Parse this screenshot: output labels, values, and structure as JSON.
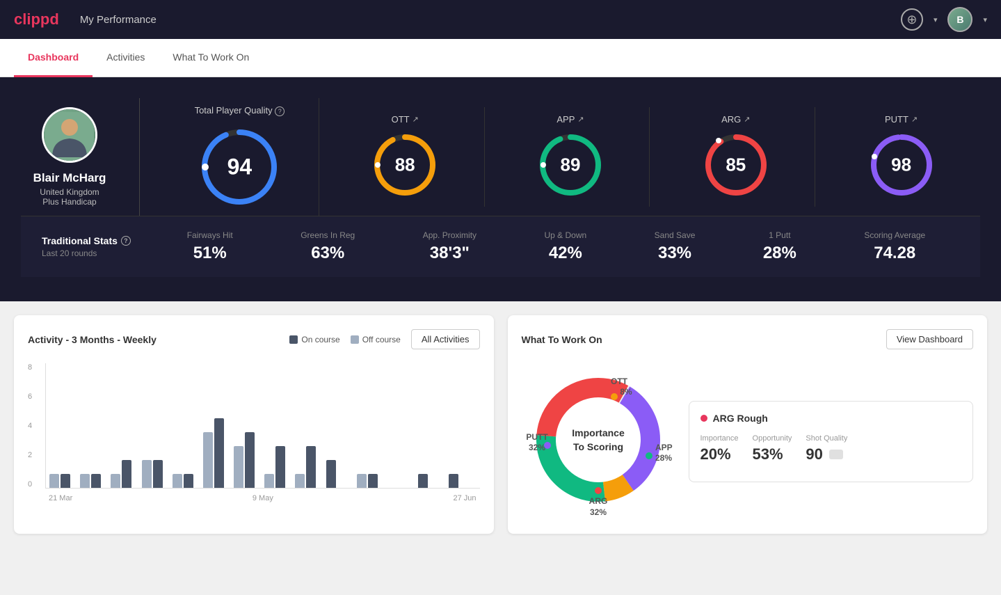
{
  "app": {
    "logo": "clippd",
    "header_title": "My Performance"
  },
  "nav": {
    "tabs": [
      {
        "id": "dashboard",
        "label": "Dashboard",
        "active": true
      },
      {
        "id": "activities",
        "label": "Activities",
        "active": false
      },
      {
        "id": "what-to-work-on",
        "label": "What To Work On",
        "active": false
      }
    ]
  },
  "player": {
    "name": "Blair McHarg",
    "country": "United Kingdom",
    "handicap": "Plus Handicap"
  },
  "scores": {
    "total": {
      "label": "Total Player Quality",
      "value": 94,
      "color": "#3b82f6"
    },
    "ott": {
      "label": "OTT",
      "value": 88,
      "color": "#f59e0b",
      "trend": "↗"
    },
    "app": {
      "label": "APP",
      "value": 89,
      "color": "#10b981",
      "trend": "↗"
    },
    "arg": {
      "label": "ARG",
      "value": 85,
      "color": "#ef4444",
      "trend": "↗"
    },
    "putt": {
      "label": "PUTT",
      "value": 98,
      "color": "#8b5cf6",
      "trend": "↗"
    }
  },
  "traditional_stats": {
    "title": "Traditional Stats",
    "subtitle": "Last 20 rounds",
    "stats": [
      {
        "label": "Fairways Hit",
        "value": "51%"
      },
      {
        "label": "Greens In Reg",
        "value": "63%"
      },
      {
        "label": "App. Proximity",
        "value": "38'3\""
      },
      {
        "label": "Up & Down",
        "value": "42%"
      },
      {
        "label": "Sand Save",
        "value": "33%"
      },
      {
        "label": "1 Putt",
        "value": "28%"
      },
      {
        "label": "Scoring Average",
        "value": "74.28"
      }
    ]
  },
  "activity_chart": {
    "title": "Activity - 3 Months - Weekly",
    "legend": {
      "on_course": "On course",
      "off_course": "Off course"
    },
    "all_activities_btn": "All Activities",
    "x_labels": [
      "21 Mar",
      "9 May",
      "27 Jun"
    ],
    "y_labels": [
      "0",
      "2",
      "4",
      "6",
      "8"
    ],
    "bars": [
      {
        "on": 1,
        "off": 1
      },
      {
        "on": 1,
        "off": 1
      },
      {
        "on": 2,
        "off": 1
      },
      {
        "on": 2,
        "off": 2
      },
      {
        "on": 1,
        "off": 1
      },
      {
        "on": 5,
        "off": 4
      },
      {
        "on": 4,
        "off": 3
      },
      {
        "on": 3,
        "off": 1
      },
      {
        "on": 3,
        "off": 1
      },
      {
        "on": 2,
        "off": 0
      },
      {
        "on": 1,
        "off": 1
      },
      {
        "on": 0,
        "off": 0
      },
      {
        "on": 1,
        "off": 0
      },
      {
        "on": 1,
        "off": 0
      }
    ]
  },
  "what_to_work_on": {
    "title": "What To Work On",
    "view_dashboard_btn": "View Dashboard",
    "donut_label": "Importance\nTo Scoring",
    "segments": [
      {
        "label": "OTT",
        "value": "8%",
        "color": "#f59e0b"
      },
      {
        "label": "APP",
        "value": "28%",
        "color": "#10b981"
      },
      {
        "label": "ARG",
        "value": "32%",
        "color": "#ef4444"
      },
      {
        "label": "PUTT",
        "value": "32%",
        "color": "#8b5cf6"
      }
    ],
    "detail_card": {
      "title": "ARG Rough",
      "metrics": [
        {
          "label": "Importance",
          "value": "20%",
          "color": "#e8365d"
        },
        {
          "label": "Opportunity",
          "value": "53%",
          "color": "#e8365d"
        },
        {
          "label": "Shot Quality",
          "value": "90",
          "color": "#e8365d"
        }
      ]
    }
  }
}
